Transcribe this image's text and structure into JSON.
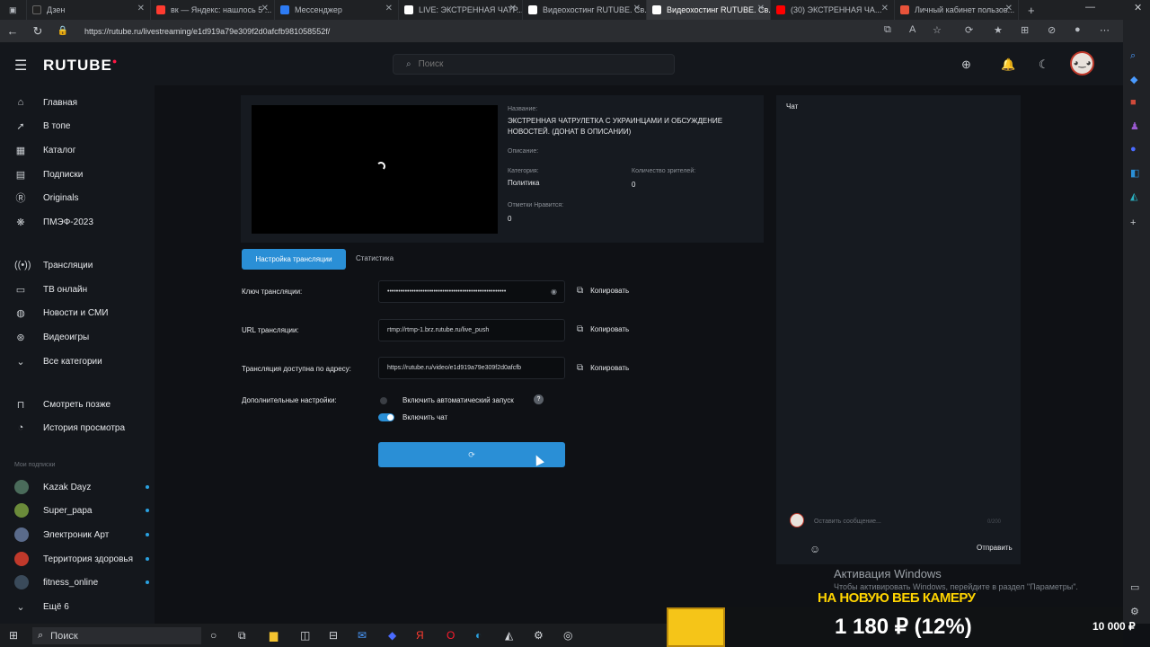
{
  "browser": {
    "tabs": [
      {
        "title": "Дзен",
        "color": "#222222"
      },
      {
        "title": "вк — Яндекс: нашлось 5 ...",
        "color": "#ff3b30"
      },
      {
        "title": "Мессенджер",
        "color": "#2d7bf4"
      },
      {
        "title": "LIVE: ЭКСТРЕННАЯ ЧАТР...",
        "color": "#ffffff"
      },
      {
        "title": "Видеохостинг RUTUBE. Св...",
        "color": "#ffffff"
      },
      {
        "title": "Видеохостинг RUTUBE. Св...",
        "color": "#ffffff"
      },
      {
        "title": "(30) ЭКСТРЕННАЯ ЧА...",
        "color": "#ff0000"
      },
      {
        "title": "Личный кабинет пользов...",
        "color": "#e8533a"
      }
    ],
    "url": "https://rutube.ru/livestreaming/e1d919a79e309f2d0afcfb981058552f/"
  },
  "header": {
    "logo": "RUTUBE",
    "search_placeholder": "Поиск",
    "avatar_text": "◕‿◕"
  },
  "sidebar": {
    "nav": [
      "Главная",
      "В топе",
      "Каталог",
      "Подписки",
      "Originals",
      "ПМЭФ-2023"
    ],
    "nav2": [
      "Трансляции",
      "ТВ онлайн",
      "Новости и СМИ",
      "Видеоигры",
      "Все категории"
    ],
    "nav3": [
      "Смотреть позже",
      "История просмотра"
    ],
    "subs_label": "Мои подписки",
    "subs": [
      {
        "name": "Kazak Dayz",
        "color": "#4a6b5a"
      },
      {
        "name": "Super_papa",
        "color": "#6b8b3a"
      },
      {
        "name": "Электроник Арт",
        "color": "#5a6b8b"
      },
      {
        "name": "Территория здоровья",
        "color": "#c0392b"
      },
      {
        "name": "fitness_online",
        "color": "#3a4a5a"
      }
    ],
    "more": "Ещё 6"
  },
  "stream": {
    "title_label": "Название:",
    "title_line1": "ЭКСТРЕННАЯ ЧАТРУЛЕТКА С УКРАИНЦАМИ И ОБСУЖДЕНИЕ",
    "title_line2": "НОВОСТЕЙ. (ДОНАТ В ОПИСАНИИ)",
    "desc_label": "Описание:",
    "category_label": "Категория:",
    "category": "Политика",
    "viewers_label": "Количество зрителей:",
    "viewers": "0",
    "likes_label": "Отметки Нравится:",
    "likes": "0"
  },
  "settings": {
    "tab_active": "Настройка трансляции",
    "tab_stats": "Статистика",
    "key_label": "Ключ трансляции:",
    "key_value": "••••••••••••••••••••••••••••••••••••••••••••••••••••••",
    "url_label": "URL трансляции:",
    "url_value": "rtmp://rtmp-1.brz.rutube.ru/live_push",
    "public_label": "Трансляция доступна по адресу:",
    "public_value": "https://rutube.ru/video/e1d919a79e309f2d0afcfb",
    "copy": "Копировать",
    "extra_label": "Дополнительные настройки:",
    "auto_start": "Включить автоматический запуск",
    "enable_chat": "Включить чат",
    "save_spinner": "⟳"
  },
  "chat": {
    "title": "Чат",
    "placeholder": "Оставить сообщение...",
    "counter": "0/200",
    "send": "Отправить"
  },
  "overlay": {
    "activation": "Активация Windows",
    "activation_hint": "Чтобы активировать Windows, перейдите в раздел \"Параметры\".",
    "banner": "НА НОВУЮ ВЕБ КАМЕРУ",
    "amount": "1 180 ₽ (12%)",
    "goal": "10 000 ₽"
  },
  "taskbar": {
    "search": "Поиск"
  },
  "colors": {
    "accent": "#2a8fd6",
    "brand_red": "#ff1744"
  }
}
